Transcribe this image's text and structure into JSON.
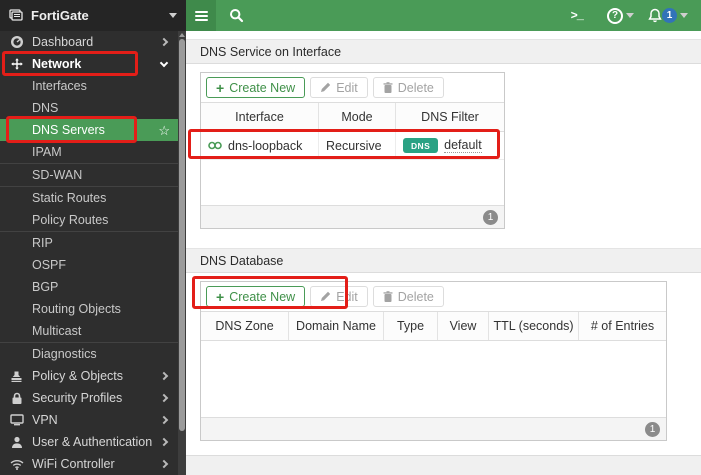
{
  "colors": {
    "accent_green": "#4a9b57",
    "badge_teal": "#2aa284",
    "notification_blue": "#3273b8",
    "annotation_red": "#e31e18"
  },
  "sidebar": {
    "brand": {
      "label": "FortiGate",
      "icon": "fortigate-device-icon"
    },
    "items": [
      {
        "label": "Dashboard",
        "icon": "gauge-icon"
      },
      {
        "label": "Network",
        "icon": "move-arrows-icon"
      },
      {
        "label": "Interfaces"
      },
      {
        "label": "DNS"
      },
      {
        "label": "DNS Servers",
        "favorite_icon": "☆"
      },
      {
        "label": "IPAM"
      },
      {
        "label": "SD-WAN"
      },
      {
        "label": "Static Routes"
      },
      {
        "label": "Policy Routes"
      },
      {
        "label": "RIP"
      },
      {
        "label": "OSPF"
      },
      {
        "label": "BGP"
      },
      {
        "label": "Routing Objects"
      },
      {
        "label": "Multicast"
      },
      {
        "label": "Diagnostics"
      },
      {
        "label": "Policy & Objects",
        "icon": "stamp-icon"
      },
      {
        "label": "Security Profiles",
        "icon": "lock-icon"
      },
      {
        "label": "VPN",
        "icon": "monitor-icon"
      },
      {
        "label": "User & Authentication",
        "icon": "user-icon"
      },
      {
        "label": "WiFi Controller",
        "icon": "wifi-icon"
      }
    ]
  },
  "topbar": {
    "cli_icon_glyph": ">_",
    "help_icon_glyph": "?",
    "notification_count": "1"
  },
  "sections": [
    {
      "title": "DNS Service on Interface",
      "toolbar": {
        "create": "Create New",
        "edit": "Edit",
        "delete": "Delete",
        "plus_glyph": "+"
      },
      "columns": [
        "Interface",
        "Mode",
        "DNS Filter"
      ],
      "rows": [
        {
          "interface": "dns-loopback",
          "mode": "Recursive",
          "dns_filter_badge": "DNS",
          "dns_filter_profile": "default"
        }
      ],
      "page_badge": "1"
    },
    {
      "title": "DNS Database",
      "toolbar": {
        "create": "Create New",
        "edit": "Edit",
        "delete": "Delete",
        "plus_glyph": "+"
      },
      "columns": [
        "DNS Zone",
        "Domain Name",
        "Type",
        "View",
        "TTL (seconds)",
        "# of Entries"
      ],
      "rows": [],
      "page_badge": "1"
    }
  ]
}
